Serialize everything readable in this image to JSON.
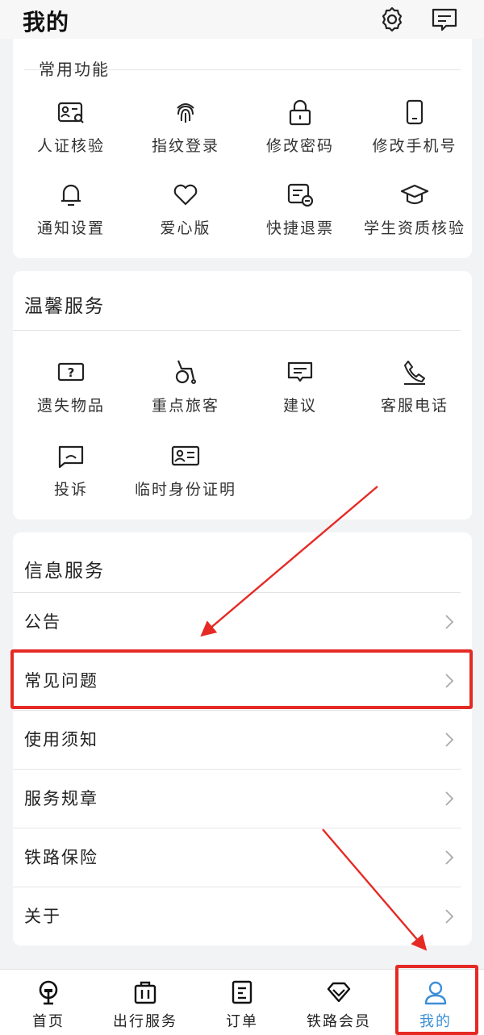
{
  "header": {
    "title": "我的"
  },
  "common": {
    "title": "常用功能",
    "items": [
      {
        "label": "人证核验",
        "icon": "id-verify-icon"
      },
      {
        "label": "指纹登录",
        "icon": "fingerprint-icon"
      },
      {
        "label": "修改密码",
        "icon": "lock-icon"
      },
      {
        "label": "修改手机号",
        "icon": "phone-icon"
      },
      {
        "label": "通知设置",
        "icon": "bell-icon"
      },
      {
        "label": "爱心版",
        "icon": "heart-icon"
      },
      {
        "label": "快捷退票",
        "icon": "ticket-refund-icon"
      },
      {
        "label": "学生资质核验",
        "icon": "graduation-cap-icon"
      }
    ]
  },
  "warm": {
    "title": "温馨服务",
    "items": [
      {
        "label": "遗失物品",
        "icon": "question-box-icon"
      },
      {
        "label": "重点旅客",
        "icon": "wheelchair-icon"
      },
      {
        "label": "建议",
        "icon": "suggestion-icon"
      },
      {
        "label": "客服电话",
        "icon": "phone-call-icon"
      },
      {
        "label": "投诉",
        "icon": "complaint-icon"
      },
      {
        "label": "临时身份证明",
        "icon": "id-card-icon"
      }
    ]
  },
  "info": {
    "title": "信息服务",
    "items": [
      {
        "label": "公告"
      },
      {
        "label": "常见问题"
      },
      {
        "label": "使用须知"
      },
      {
        "label": "服务规章"
      },
      {
        "label": "铁路保险"
      },
      {
        "label": "关于"
      }
    ]
  },
  "nav": {
    "items": [
      {
        "label": "首页",
        "icon": "home-train-icon"
      },
      {
        "label": "出行服务",
        "icon": "luggage-icon"
      },
      {
        "label": "订单",
        "icon": "order-icon"
      },
      {
        "label": "铁路会员",
        "icon": "diamond-icon"
      },
      {
        "label": "我的",
        "icon": "user-icon"
      }
    ],
    "active_index": 4
  },
  "colors": {
    "accent": "#3b8fd6",
    "annotation": "#e52a25"
  }
}
